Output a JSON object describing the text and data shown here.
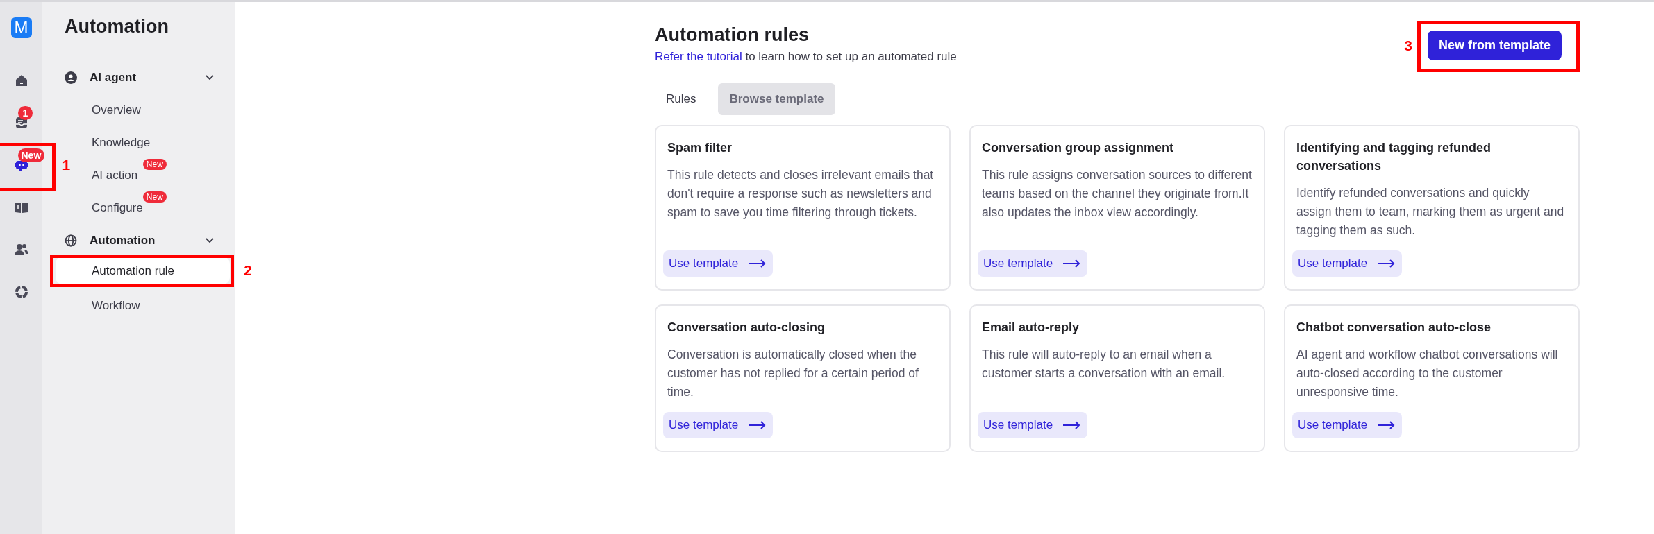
{
  "rail": {
    "logo": "M",
    "items": [
      {
        "kind": "home",
        "selected": false
      },
      {
        "kind": "inbox",
        "selected": false,
        "badge": "1"
      },
      {
        "kind": "bot",
        "selected": true,
        "badge": "New",
        "annotation": "1"
      },
      {
        "kind": "book",
        "selected": false
      },
      {
        "kind": "people",
        "selected": false
      },
      {
        "kind": "chart",
        "selected": false
      }
    ]
  },
  "sidebar": {
    "title": "Automation",
    "groups": [
      {
        "label": "AI agent",
        "kind": "agent",
        "expanded": true,
        "items": [
          {
            "label": "Overview",
            "selected": false
          },
          {
            "label": "Knowledge",
            "selected": false
          },
          {
            "label": "AI action",
            "selected": false,
            "badge": "New"
          },
          {
            "label": "Configure",
            "selected": false,
            "badge": "New"
          }
        ]
      },
      {
        "label": "Automation",
        "kind": "globe",
        "expanded": true,
        "items": [
          {
            "label": "Automation rule",
            "selected": true,
            "annotation": "2"
          },
          {
            "label": "Workflow",
            "selected": false
          }
        ]
      }
    ]
  },
  "main": {
    "title": "Automation rules",
    "subtitle": {
      "link": "Refer the tutorial",
      "text": "to learn how to set up an automated rule"
    },
    "button": {
      "label": "New from template",
      "annotation": "3"
    },
    "tabs": [
      {
        "label": "Rules",
        "selected": false
      },
      {
        "label": "Browse template",
        "selected": true
      }
    ],
    "cards": [
      {
        "title": "Spam filter",
        "description": "This rule detects and closes irrelevant emails that don't require a response such as newsletters and spam to save you time filtering through tickets.",
        "action": "Use template"
      },
      {
        "title": "Conversation group assignment",
        "description": "This rule assigns conversation sources to different teams based on the channel they originate from.It also updates the inbox view accordingly.",
        "action": "Use template"
      },
      {
        "title": "Identifying and tagging refunded conversations",
        "description": "Identify refunded conversations and quickly assign them to team, marking them as urgent and tagging them as such.",
        "action": "Use template"
      },
      {
        "title": "Conversation auto-closing",
        "description": "Conversation is automatically closed when the customer has not replied for a certain period of time.",
        "action": "Use template"
      },
      {
        "title": "Email auto-reply",
        "description": "This rule will auto-reply to an email when a customer starts a conversation with an email.",
        "action": "Use template"
      },
      {
        "title": "Chatbot conversation auto-close",
        "description": "AI agent and workflow chatbot conversations will auto-closed according to the customer unresponsive time.",
        "action": "Use template"
      }
    ]
  }
}
